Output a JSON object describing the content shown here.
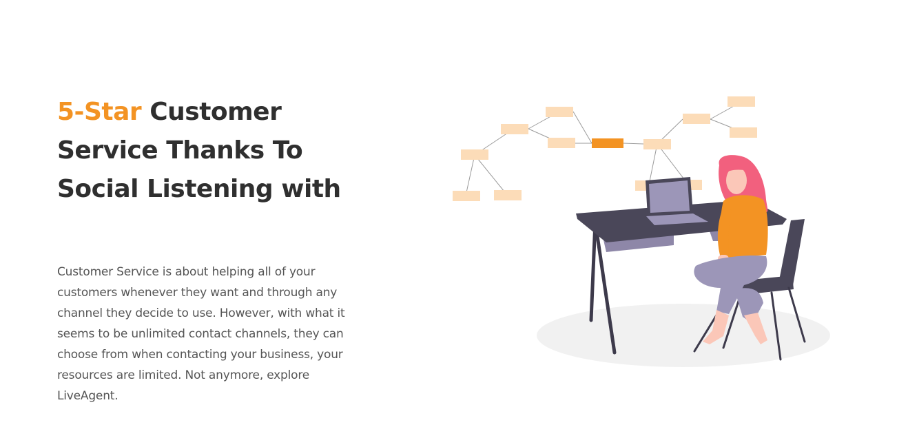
{
  "hero": {
    "title_accent": "5-Star",
    "title_rest": " Customer Service Thanks To Social Listening with",
    "description": "Customer Service is about helping all of your customers whenever they want and through any channel they decide to use. However, with what it seems to be unlimited contact channels, they can choose from when contacting your business, your resources are limited. Not anymore, explore LiveAgent."
  },
  "colors": {
    "accent": "#f39323",
    "heading": "#2f2f2f",
    "body_text": "#555555",
    "node": "#fcdcb8",
    "desk": "#4a4759",
    "hair": "#f2607e"
  },
  "illustration": {
    "name": "person-at-desk-mind-map",
    "icon": "illustration-icon"
  }
}
